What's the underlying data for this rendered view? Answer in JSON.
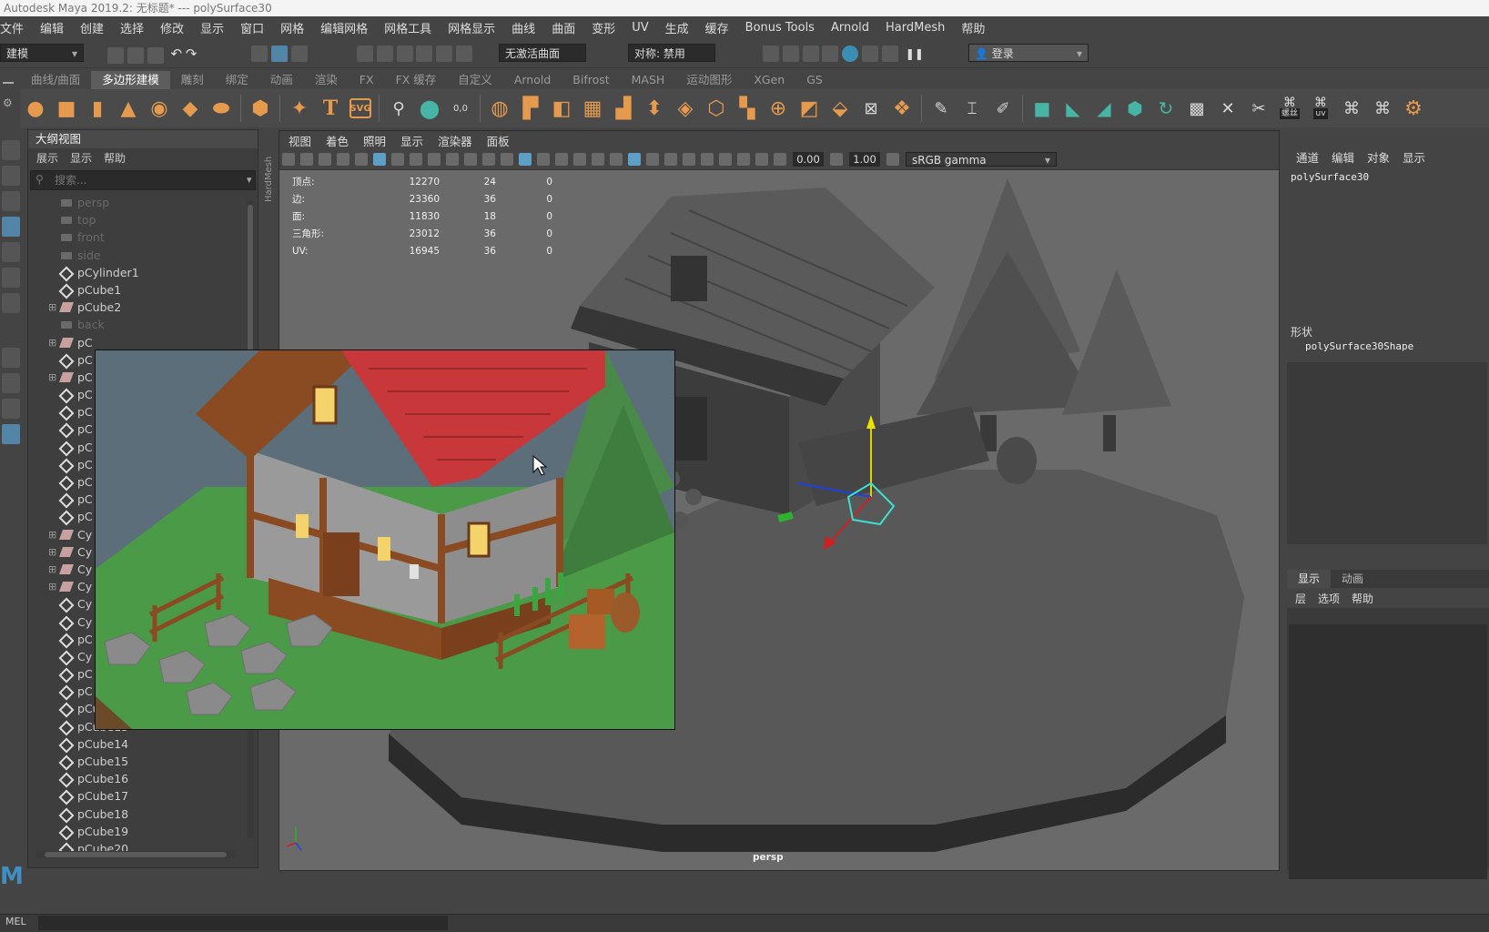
{
  "window": {
    "title": "Autodesk Maya 2019.2: 无标题*   ---   polySurface30"
  },
  "menubar": {
    "items": [
      "文件",
      "编辑",
      "创建",
      "选择",
      "修改",
      "显示",
      "窗口",
      "网格",
      "编辑网格",
      "网格工具",
      "网格显示",
      "曲线",
      "曲面",
      "变形",
      "UV",
      "生成",
      "缓存",
      "Bonus Tools",
      "Arnold",
      "HardMesh",
      "帮助"
    ]
  },
  "statusline": {
    "mode": "建模",
    "live_surface": "无激活曲面",
    "symmetry": "对称: 禁用",
    "login": "登录"
  },
  "shelf": {
    "tabs": [
      "曲线/曲面",
      "多边形建模",
      "雕刻",
      "绑定",
      "动画",
      "渲染",
      "FX",
      "FX 缓存",
      "自定义",
      "Arnold",
      "Bifrost",
      "MASH",
      "运动图形",
      "XGen",
      "GS"
    ],
    "active_tab": "多边形建模",
    "labels": {
      "helix": "螺丝",
      "uv": "uv"
    }
  },
  "outliner": {
    "title": "大纲视图",
    "menu": [
      "展示",
      "显示",
      "帮助"
    ],
    "search_placeholder": "搜索...",
    "items": [
      {
        "name": "persp",
        "type": "camera",
        "dim": true
      },
      {
        "name": "top",
        "type": "camera",
        "dim": true
      },
      {
        "name": "front",
        "type": "camera",
        "dim": true
      },
      {
        "name": "side",
        "type": "camera",
        "dim": true
      },
      {
        "name": "pCylinder1",
        "type": "mesh"
      },
      {
        "name": "pCube1",
        "type": "mesh"
      },
      {
        "name": "pCube2",
        "type": "group",
        "expand": true
      },
      {
        "name": "back",
        "type": "camera",
        "dim": true
      },
      {
        "name": "pC",
        "type": "group",
        "expand": true
      },
      {
        "name": "pC",
        "type": "mesh"
      },
      {
        "name": "pC",
        "type": "group",
        "expand": true
      },
      {
        "name": "pC",
        "type": "mesh"
      },
      {
        "name": "pC",
        "type": "mesh"
      },
      {
        "name": "pC",
        "type": "mesh"
      },
      {
        "name": "pC",
        "type": "mesh"
      },
      {
        "name": "pC",
        "type": "mesh"
      },
      {
        "name": "pC",
        "type": "mesh"
      },
      {
        "name": "pC",
        "type": "mesh"
      },
      {
        "name": "pC",
        "type": "mesh"
      },
      {
        "name": "Cy",
        "type": "group",
        "expand": true
      },
      {
        "name": "Cy",
        "type": "group",
        "expand": true
      },
      {
        "name": "Cy",
        "type": "group",
        "expand": true
      },
      {
        "name": "Cy",
        "type": "group",
        "expand": true
      },
      {
        "name": "Cy",
        "type": "mesh"
      },
      {
        "name": "Cy",
        "type": "mesh"
      },
      {
        "name": "pC",
        "type": "mesh"
      },
      {
        "name": "Cy",
        "type": "mesh"
      },
      {
        "name": "pC",
        "type": "mesh"
      },
      {
        "name": "pC",
        "type": "mesh"
      },
      {
        "name": "pCube12",
        "type": "mesh"
      },
      {
        "name": "pCube13",
        "type": "mesh"
      },
      {
        "name": "pCube14",
        "type": "mesh"
      },
      {
        "name": "pCube15",
        "type": "mesh"
      },
      {
        "name": "pCube16",
        "type": "mesh"
      },
      {
        "name": "pCube17",
        "type": "mesh"
      },
      {
        "name": "pCube18",
        "type": "mesh"
      },
      {
        "name": "pCube19",
        "type": "mesh"
      },
      {
        "name": "pCube20",
        "type": "mesh"
      }
    ]
  },
  "viewport": {
    "menu": [
      "视图",
      "着色",
      "照明",
      "显示",
      "渲染器",
      "面板"
    ],
    "exposure": "0.00",
    "gamma": "1.00",
    "colorspace": "sRGB gamma",
    "camera_label": "persp",
    "side_label": "HardMesh",
    "hud": [
      {
        "label": "顶点:",
        "a": "12270",
        "b": "24",
        "c": "0"
      },
      {
        "label": "边:",
        "a": "23360",
        "b": "36",
        "c": "0"
      },
      {
        "label": "面:",
        "a": "11830",
        "b": "18",
        "c": "0"
      },
      {
        "label": "三角形:",
        "a": "23012",
        "b": "36",
        "c": "0"
      },
      {
        "label": "UV:",
        "a": "16945",
        "b": "36",
        "c": "0"
      }
    ]
  },
  "channelbox": {
    "menu": [
      "通道",
      "编辑",
      "对象",
      "显示"
    ],
    "object": "polySurface30",
    "shape_header": "形状",
    "shape": "polySurface30Shape"
  },
  "layers": {
    "tabs": [
      "显示",
      "动画"
    ],
    "menu": [
      "层",
      "选项",
      "帮助"
    ]
  },
  "bottom": {
    "mel": "MEL"
  },
  "colors": {
    "roof_red": "#c8383a",
    "grass_green": "#4a9a48",
    "wood_brown": "#8a4a22",
    "selection_blue": "#5285a6"
  }
}
